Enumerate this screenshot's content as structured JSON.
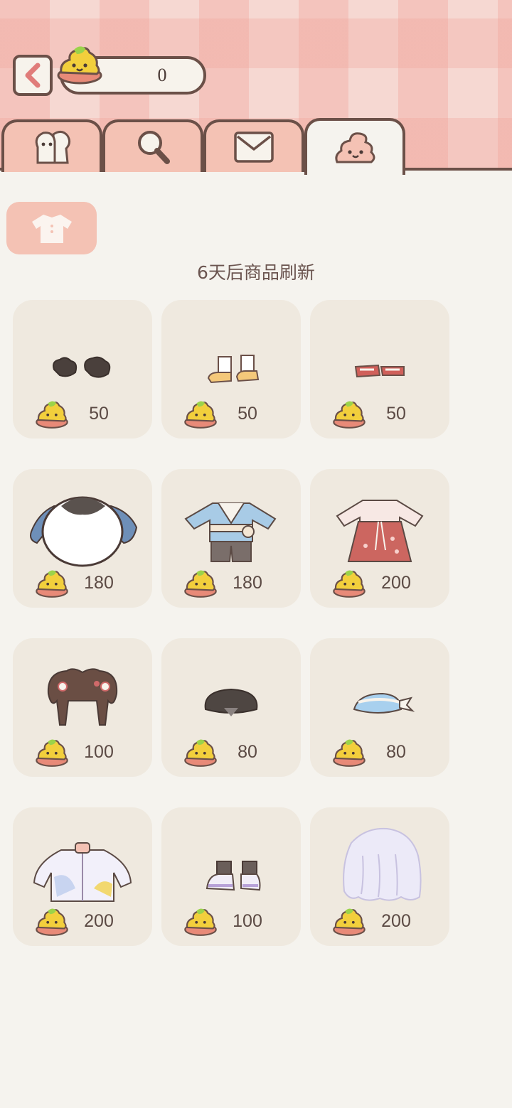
{
  "header": {
    "coin_count": "0"
  },
  "tabs": [
    {
      "name": "characters",
      "icon": "characters-icon"
    },
    {
      "name": "search",
      "icon": "magnifier-icon"
    },
    {
      "name": "mail",
      "icon": "envelope-icon"
    },
    {
      "name": "shop",
      "icon": "poop-icon",
      "active": true
    }
  ],
  "filter": {
    "icon": "shirt-icon"
  },
  "refresh_note": "6天后商品刷新",
  "items": [
    {
      "icon": "dark-shoes-icon",
      "price": "50"
    },
    {
      "icon": "white-socks-shoes-icon",
      "price": "50"
    },
    {
      "icon": "red-shoes-icon",
      "price": "50"
    },
    {
      "icon": "white-sweater-icon",
      "price": "180"
    },
    {
      "icon": "blue-hanfu-outfit-icon",
      "price": "180"
    },
    {
      "icon": "red-hanfu-dress-icon",
      "price": "200"
    },
    {
      "icon": "braided-hair-icon",
      "price": "100"
    },
    {
      "icon": "dark-hat-icon",
      "price": "80"
    },
    {
      "icon": "blue-bucket-hat-icon",
      "price": "80"
    },
    {
      "icon": "pastel-jacket-icon",
      "price": "200"
    },
    {
      "icon": "purple-sneakers-icon",
      "price": "100"
    },
    {
      "icon": "silver-hair-icon",
      "price": "200"
    }
  ],
  "colors": {
    "accent": "#f4c2b4",
    "outline": "#6b5048",
    "card": "#efe9df",
    "background": "#f5f3ee"
  }
}
